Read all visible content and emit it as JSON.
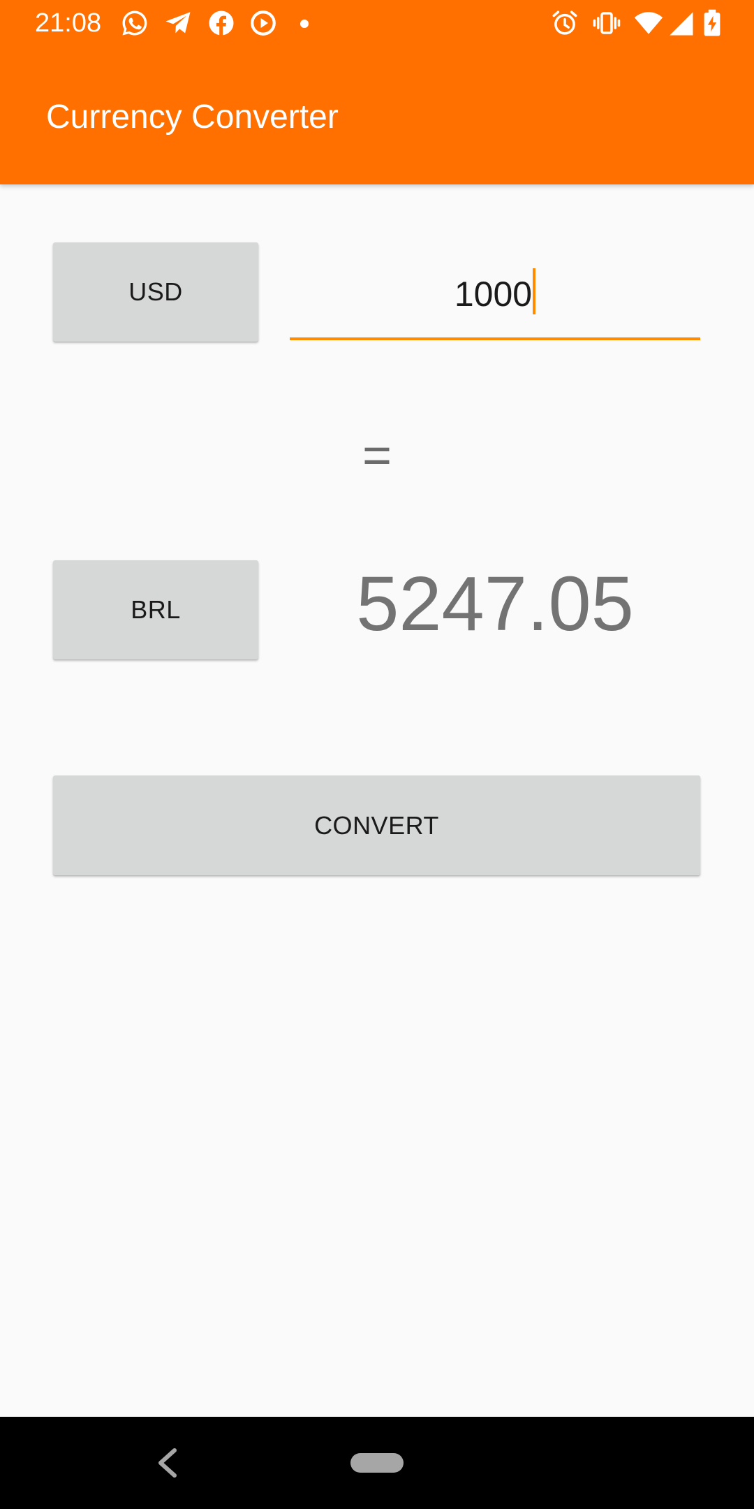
{
  "status_bar": {
    "time": "21:08",
    "icons": [
      "whatsapp-icon",
      "telegram-icon",
      "facebook-icon",
      "play-icon",
      "dot-icon",
      "alarm-icon",
      "vibrate-icon",
      "wifi-icon",
      "signal-icon",
      "battery-charging-icon"
    ]
  },
  "app_bar": {
    "title": "Currency Converter"
  },
  "converter": {
    "from_currency": "USD",
    "amount": "1000",
    "equals": "=",
    "to_currency": "BRL",
    "result": "5247.05",
    "convert_label": "CONVERT"
  },
  "colors": {
    "primary": "#ff7000",
    "accent": "#ff8c00",
    "button_bg": "#d6d7d7",
    "background": "#fafafa"
  },
  "nav_bar": {
    "icons": [
      "back-icon",
      "home-pill-icon"
    ]
  }
}
